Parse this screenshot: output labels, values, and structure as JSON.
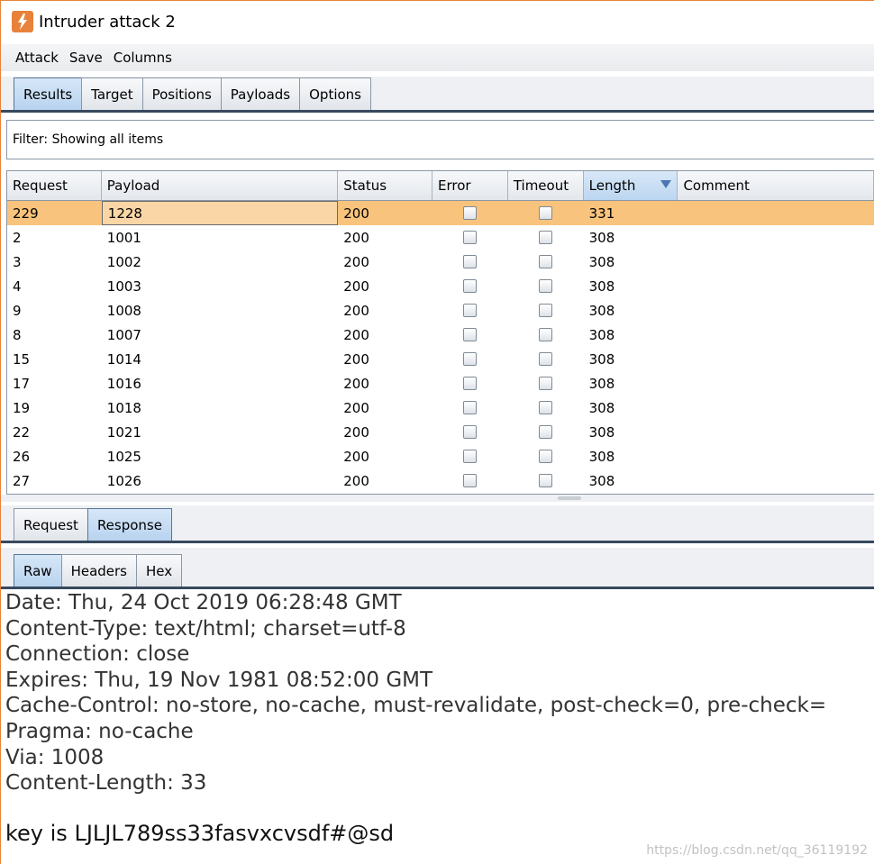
{
  "window": {
    "title": "Intruder attack 2"
  },
  "menu": [
    "Attack",
    "Save",
    "Columns"
  ],
  "main_tabs": [
    "Results",
    "Target",
    "Positions",
    "Payloads",
    "Options"
  ],
  "filter": {
    "text": "Filter:  Showing all items"
  },
  "table": {
    "columns": [
      "Request",
      "Payload",
      "Status",
      "Error",
      "Timeout",
      "Length",
      "Comment"
    ],
    "rows": [
      {
        "request": "229",
        "payload": "1228",
        "status": "200",
        "length": "331"
      },
      {
        "request": "2",
        "payload": "1001",
        "status": "200",
        "length": "308"
      },
      {
        "request": "3",
        "payload": "1002",
        "status": "200",
        "length": "308"
      },
      {
        "request": "4",
        "payload": "1003",
        "status": "200",
        "length": "308"
      },
      {
        "request": "9",
        "payload": "1008",
        "status": "200",
        "length": "308"
      },
      {
        "request": "8",
        "payload": "1007",
        "status": "200",
        "length": "308"
      },
      {
        "request": "15",
        "payload": "1014",
        "status": "200",
        "length": "308"
      },
      {
        "request": "17",
        "payload": "1016",
        "status": "200",
        "length": "308"
      },
      {
        "request": "19",
        "payload": "1018",
        "status": "200",
        "length": "308"
      },
      {
        "request": "22",
        "payload": "1021",
        "status": "200",
        "length": "308"
      },
      {
        "request": "26",
        "payload": "1025",
        "status": "200",
        "length": "308"
      },
      {
        "request": "27",
        "payload": "1026",
        "status": "200",
        "length": "308"
      }
    ]
  },
  "req_tabs": [
    "Request",
    "Response"
  ],
  "view_tabs": [
    "Raw",
    "Headers",
    "Hex"
  ],
  "response": {
    "lines": [
      "Date: Thu, 24 Oct 2019 06:28:48 GMT",
      "Content-Type: text/html; charset=utf-8",
      "Connection: close",
      "Expires: Thu, 19 Nov 1981 08:52:00 GMT",
      "Cache-Control: no-store, no-cache, must-revalidate, post-check=0, pre-check=",
      "Pragma: no-cache",
      "Via: 1008",
      "Content-Length: 33"
    ],
    "key": "key is LJLJL789ss33fasvxcvsdf#@sd"
  },
  "watermark": "https://blog.csdn.net/qq_36119192"
}
